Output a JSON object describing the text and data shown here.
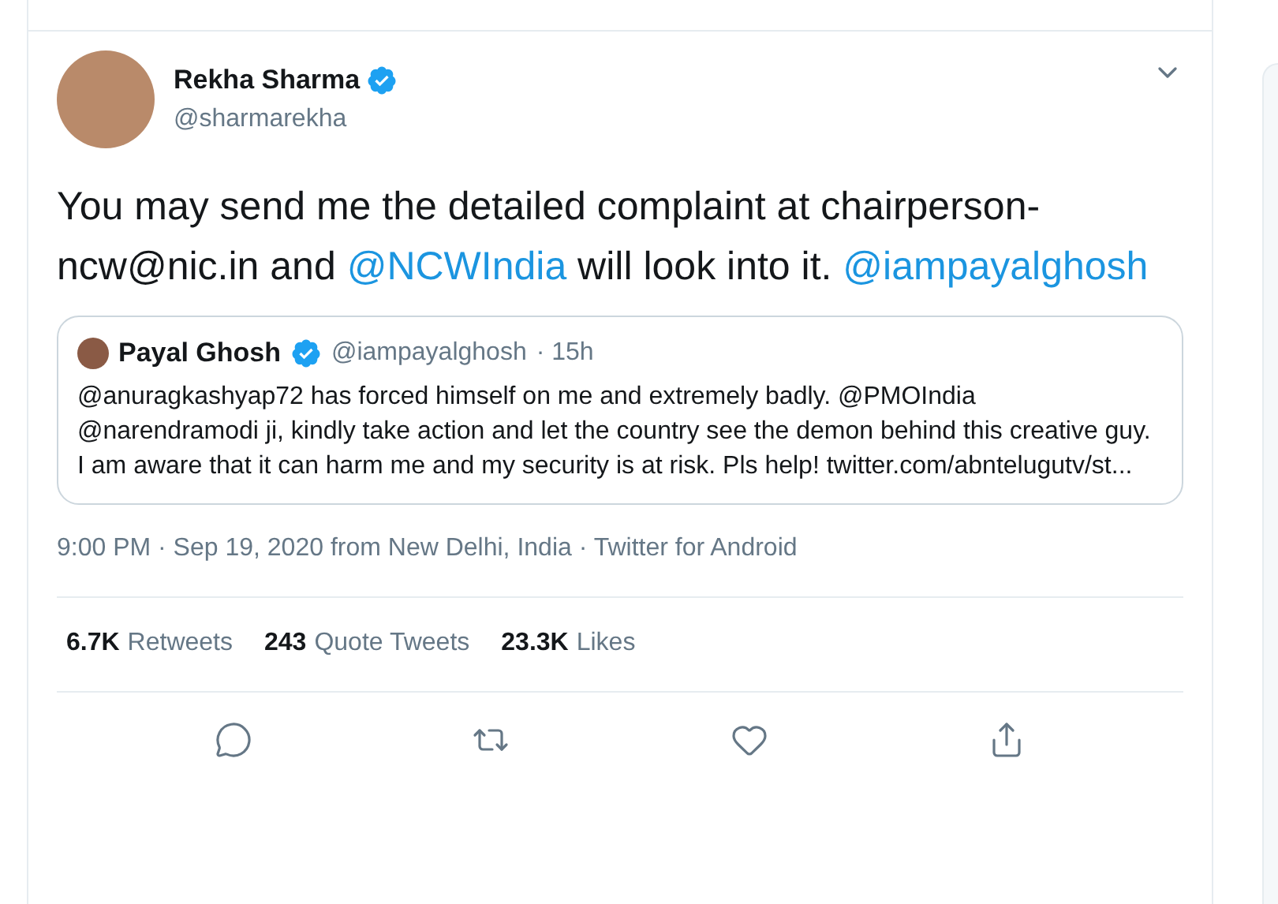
{
  "tweet": {
    "author": {
      "name": "Rekha Sharma",
      "verified": true,
      "handle": "@sharmarekha"
    },
    "text": [
      {
        "kind": "text",
        "value": "You may send me the detailed complaint at chairperson-ncw@nic.in and "
      },
      {
        "kind": "mention",
        "value": "@NCWIndia"
      },
      {
        "kind": "text",
        "value": " will look into it. "
      },
      {
        "kind": "mention",
        "value": "@iampayalghosh"
      }
    ],
    "quoted": {
      "name": "Payal Ghosh",
      "verified": true,
      "handle": "@iampayalghosh",
      "time": "· 15h",
      "text": "@anuragkashyap72 has forced himself on me and extremely badly. @PMOIndia @narendramodi ji, kindly take action and let the country see the demon behind this creative guy. I am aware that it can harm me and my security is at risk. Pls help! twitter.com/abntelugutv/st..."
    },
    "meta": "9:00 PM · Sep 19, 2020 from New Delhi, India · Twitter for Android",
    "stats": [
      {
        "count": "6.7K",
        "label": "Retweets"
      },
      {
        "count": "243",
        "label": "Quote Tweets"
      },
      {
        "count": "23.3K",
        "label": "Likes"
      }
    ]
  }
}
